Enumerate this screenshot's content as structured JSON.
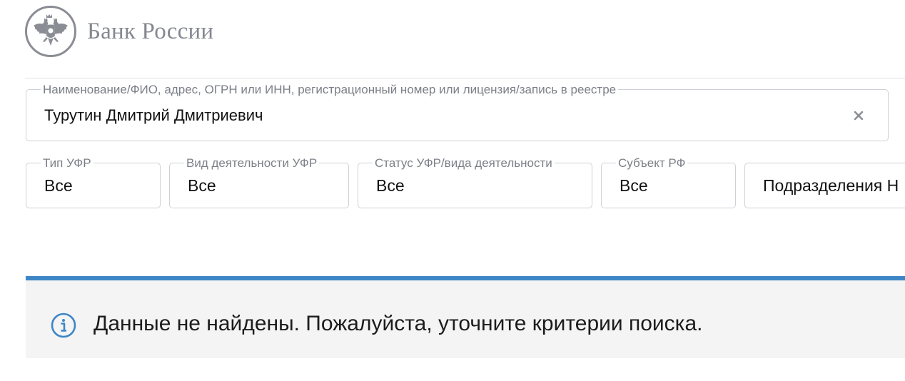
{
  "header": {
    "logo_text": "Банк России",
    "emblem_icon": "double-headed-eagle-emblem-icon"
  },
  "search": {
    "label": "Наименование/ФИО, адрес, ОГРН или ИНН, регистрационный номер или лицензия/запись в реестре",
    "value": "Турутин Дмитрий Дмитриевич",
    "clear_icon": "close-icon",
    "clear_symbol": "✕"
  },
  "filters": {
    "type": {
      "label": "Тип УФР",
      "value": "Все"
    },
    "activity": {
      "label": "Вид деятельности УФР",
      "value": "Все"
    },
    "status": {
      "label": "Статус УФР/вида деятельности",
      "value": "Все"
    },
    "subject": {
      "label": "Субъект РФ",
      "value": "Все"
    },
    "division": {
      "value": "Подразделения Н"
    }
  },
  "notice": {
    "icon": "info-icon",
    "text": "Данные не найдены. Пожалуйста, уточните критерии поиска.",
    "accent_color": "#3d86c6"
  }
}
